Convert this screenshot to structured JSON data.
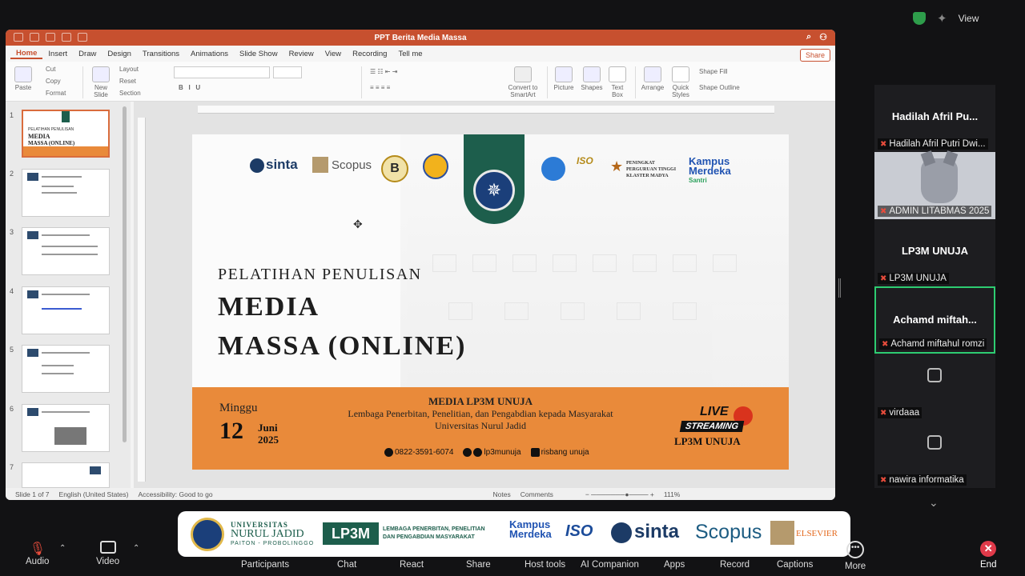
{
  "meeting": {
    "view_label": "View",
    "toolbar": {
      "audio": "Audio",
      "video": "Video",
      "participants": "Participants",
      "chat": "Chat",
      "react": "React",
      "share": "Share",
      "host_tools": "Host tools",
      "ai_companion": "AI Companion",
      "apps": "Apps",
      "record": "Record",
      "captions": "Captions",
      "more": "More",
      "end": "End"
    },
    "participants": [
      {
        "display": "Hadilah Afril Pu...",
        "label": "Hadilah Afril Putri Dwi..."
      },
      {
        "display": "",
        "label": "ADMIN LITABMAS 2025"
      },
      {
        "display": "LP3M UNUJA",
        "label": "LP3M UNUJA"
      },
      {
        "display": "Achamd miftah...",
        "label": "Achamd miftahul romzi"
      },
      {
        "display": "",
        "label": "virdaaa"
      },
      {
        "display": "",
        "label": "nawira informatika"
      }
    ]
  },
  "ppt": {
    "title": "PPT Berita Media Massa",
    "share_label": "Share",
    "tabs": [
      "Home",
      "Insert",
      "Draw",
      "Design",
      "Transitions",
      "Animations",
      "Slide Show",
      "Review",
      "View",
      "Recording",
      "Tell me"
    ],
    "ribbon": {
      "paste": "Paste",
      "cut": "Cut",
      "copy": "Copy",
      "format": "Format",
      "new_slide": "New Slide",
      "layout": "Layout",
      "reset": "Reset",
      "section": "Section",
      "convert": "Convert to SmartArt",
      "picture": "Picture",
      "shapes": "Shapes",
      "text_box": "Text Box",
      "arrange": "Arrange",
      "quick_styles": "Quick Styles",
      "shape_fill": "Shape Fill",
      "shape_outline": "Shape Outline"
    },
    "thumb_numbers": [
      "1",
      "2",
      "3",
      "4",
      "5",
      "6",
      "7"
    ],
    "thumb1_text": [
      "PELATIHAN PENULISAN",
      "MEDIA",
      "MASSA (ONLINE)"
    ],
    "status": {
      "slide": "Slide 1 of 7",
      "lang": "English (United States)",
      "access": "Accessibility: Good to go",
      "notes": "Notes",
      "comments": "Comments",
      "zoom": "111%"
    }
  },
  "slide": {
    "logos": {
      "sinta": "sinta",
      "scopus": "Scopus",
      "b": "B",
      "iso": "ISO",
      "klaster": "PENINGKAT PERGURUAN TINGGI KLASTER MADYA",
      "kampus": "Kampus",
      "merdeka": "Merdeka",
      "santri": "Santri"
    },
    "title_small": "PELATIHAN PENULISAN",
    "title_line1": "MEDIA",
    "title_line2": "MASSA (ONLINE)",
    "day_label": "Minggu",
    "day_number": "12",
    "month": "Juni",
    "year": "2025",
    "center_heading": "MEDIA LP3M UNUJA",
    "center_line1": "Lembaga Penerbitan, Penelitian, dan Pengabdian kepada Masyarakat",
    "center_line2": "Universitas Nurul Jadid",
    "phone": "0822-3591-6074",
    "instagram": "lp3munuja",
    "facebook": "risbang unuja",
    "live": "LIVE",
    "streaming": "STREAMING",
    "live_org": "LP3M UNUJA"
  },
  "banner": {
    "univ_small": "UNIVERSITAS",
    "univ_name": "NURUL JADID",
    "univ_place": "PAITON - PROBOLINGGO",
    "lp3m": "LP3M",
    "lp3m_desc1": "LEMBAGA PENERBITAN, PENELITIAN",
    "lp3m_desc2": "DAN PENGABDIAN MASYARAKAT",
    "kampus": "Kampus",
    "merdeka": "Merdeka",
    "iso": "ISO",
    "sinta": "sinta",
    "scopus": "Scopus",
    "elsevier": "ELSEVIER"
  },
  "colors": {
    "ppt_accent": "#c7502f",
    "slide_orange": "#e98a3a",
    "banner_green": "#1d5e4c",
    "active_speaker": "#2ecc71",
    "end_red": "#e03a4a"
  }
}
